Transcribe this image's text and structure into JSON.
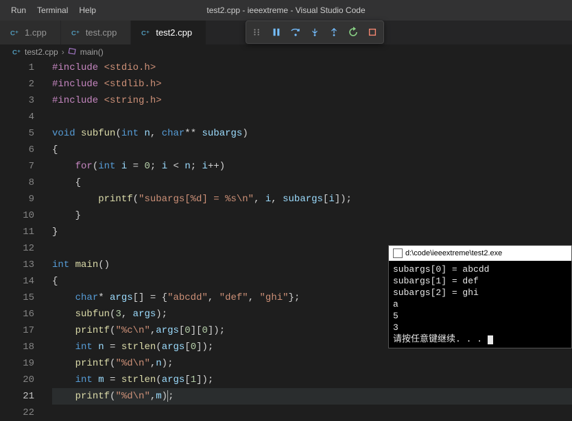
{
  "menubar": {
    "items": [
      "Run",
      "Terminal",
      "Help"
    ]
  },
  "window": {
    "title": "test2.cpp - ieeextreme - Visual Studio Code"
  },
  "tabs": [
    {
      "icon": "cpp",
      "label": "1.cpp",
      "active": false
    },
    {
      "icon": "cpp",
      "label": "test.cpp",
      "active": false
    },
    {
      "icon": "cpp",
      "label": "test2.cpp",
      "active": true
    }
  ],
  "debug_toolbar": {
    "buttons": [
      "drag-handle",
      "pause",
      "step-over",
      "step-into",
      "step-out",
      "restart",
      "stop"
    ]
  },
  "breadcrumbs": {
    "file": "test2.cpp",
    "symbol": "main()"
  },
  "editor": {
    "current_line": 21,
    "lines": [
      {
        "n": 1,
        "html": "<span class='preproc'>#include</span> <span class='string-inc'>&lt;stdio.h&gt;</span>"
      },
      {
        "n": 2,
        "html": "<span class='preproc'>#include</span> <span class='string-inc'>&lt;stdlib.h&gt;</span>"
      },
      {
        "n": 3,
        "html": "<span class='preproc'>#include</span> <span class='string-inc'>&lt;string.h&gt;</span>"
      },
      {
        "n": 4,
        "html": ""
      },
      {
        "n": 5,
        "html": "<span class='type'>void</span> <span class='func'>subfun</span><span class='punct'>(</span><span class='type'>int</span> <span class='ident'>n</span><span class='punct'>,</span> <span class='type'>char</span><span class='op'>**</span> <span class='ident'>subargs</span><span class='punct'>)</span>"
      },
      {
        "n": 6,
        "html": "<span class='punct'>{</span>"
      },
      {
        "n": 7,
        "html": "    <span class='keyword-ctrl'>for</span><span class='punct'>(</span><span class='type'>int</span> <span class='ident'>i</span> <span class='op'>=</span> <span class='num'>0</span><span class='punct'>;</span> <span class='ident'>i</span> <span class='op'>&lt;</span> <span class='ident'>n</span><span class='punct'>;</span> <span class='ident'>i</span><span class='op'>++</span><span class='punct'>)</span>"
      },
      {
        "n": 8,
        "html": "    <span class='punct'>{</span>"
      },
      {
        "n": 9,
        "html": "        <span class='func'>printf</span><span class='punct'>(</span><span class='str'>\"subargs[%d] = %s\\n\"</span><span class='punct'>,</span> <span class='ident'>i</span><span class='punct'>,</span> <span class='ident'>subargs</span><span class='punct'>[</span><span class='ident'>i</span><span class='punct'>]);</span>"
      },
      {
        "n": 10,
        "html": "    <span class='punct'>}</span>"
      },
      {
        "n": 11,
        "html": "<span class='punct'>}</span>"
      },
      {
        "n": 12,
        "html": ""
      },
      {
        "n": 13,
        "html": "<span class='type'>int</span> <span class='func'>main</span><span class='punct'>()</span>"
      },
      {
        "n": 14,
        "html": "<span class='punct'>{</span>"
      },
      {
        "n": 15,
        "html": "    <span class='type'>char</span><span class='op'>*</span> <span class='ident'>args</span><span class='punct'>[]</span> <span class='op'>=</span> <span class='punct'>{</span><span class='str'>\"abcdd\"</span><span class='punct'>,</span> <span class='str'>\"def\"</span><span class='punct'>,</span> <span class='str'>\"ghi\"</span><span class='punct'>};</span>"
      },
      {
        "n": 16,
        "html": "    <span class='func'>subfun</span><span class='punct'>(</span><span class='num'>3</span><span class='punct'>,</span> <span class='ident'>args</span><span class='punct'>);</span>"
      },
      {
        "n": 17,
        "html": "    <span class='func'>printf</span><span class='punct'>(</span><span class='str'>\"%c\\n\"</span><span class='punct'>,</span><span class='ident'>args</span><span class='punct'>[</span><span class='num'>0</span><span class='punct'>][</span><span class='num'>0</span><span class='punct'>]);</span>"
      },
      {
        "n": 18,
        "html": "    <span class='type'>int</span> <span class='ident'>n</span> <span class='op'>=</span> <span class='func'>strlen</span><span class='punct'>(</span><span class='ident'>args</span><span class='punct'>[</span><span class='num'>0</span><span class='punct'>]);</span>"
      },
      {
        "n": 19,
        "html": "    <span class='func'>printf</span><span class='punct'>(</span><span class='str'>\"%d\\n\"</span><span class='punct'>,</span><span class='ident'>n</span><span class='punct'>);</span>"
      },
      {
        "n": 20,
        "html": "    <span class='type'>int</span> <span class='ident'>m</span> <span class='op'>=</span> <span class='func'>strlen</span><span class='punct'>(</span><span class='ident'>args</span><span class='punct'>[</span><span class='num'>1</span><span class='punct'>]);</span>"
      },
      {
        "n": 21,
        "html": "    <span class='func'>printf</span><span class='punct'>(</span><span class='str'>\"%d\\n\"</span><span class='punct'>,</span><span class='ident'>m</span><span class='punct'>)<span class='caret'></span>;</span>"
      },
      {
        "n": 22,
        "html": ""
      }
    ]
  },
  "terminal": {
    "title": "d:\\code\\ieeextreme\\test2.exe",
    "output": "subargs[0] = abcdd\nsubargs[1] = def\nsubargs[2] = ghi\na\n5\n3\n请按任意键继续. . . "
  }
}
